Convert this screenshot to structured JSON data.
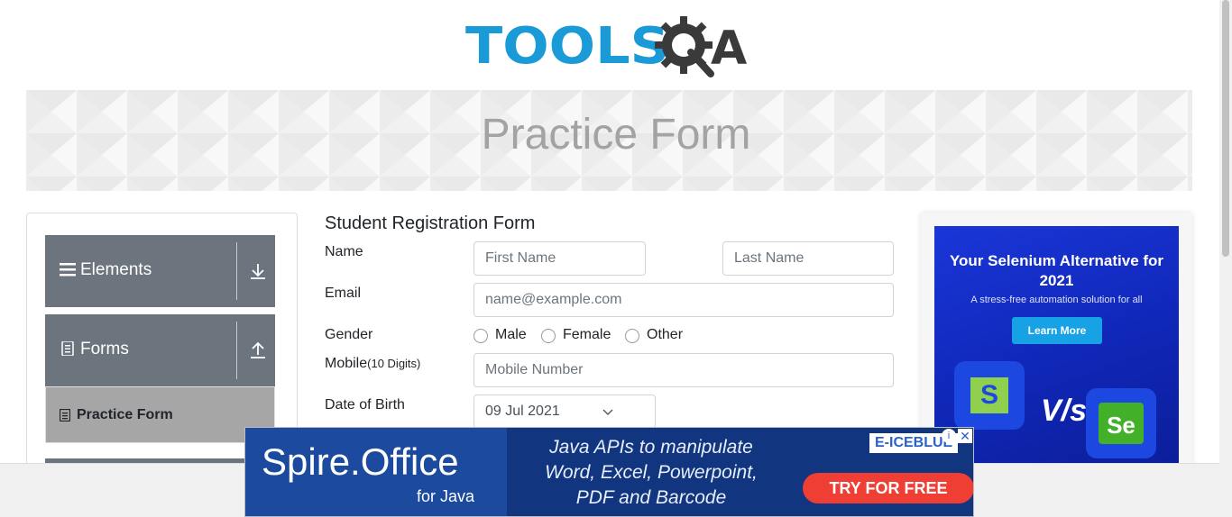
{
  "logo": {
    "text": "TOOLS",
    "suffix": "A",
    "icon": "gear-q-icon"
  },
  "banner": {
    "title": "Practice Form"
  },
  "sidebar": {
    "groups": [
      {
        "label": "Elements",
        "icon": "hamburger-icon",
        "arrow": "download-arrow-icon"
      },
      {
        "label": "Forms",
        "icon": "document-icon",
        "arrow": "upload-arrow-icon"
      }
    ],
    "active_item": {
      "label": "Practice Form",
      "icon": "file-icon"
    }
  },
  "form": {
    "title": "Student Registration Form",
    "name_label": "Name",
    "first_name_placeholder": "First Name",
    "last_name_placeholder": "Last Name",
    "email_label": "Email",
    "email_placeholder": "name@example.com",
    "gender_label": "Gender",
    "gender_options": [
      "Male",
      "Female",
      "Other"
    ],
    "mobile_label": "Mobile",
    "mobile_hint": "(10 Digits)",
    "mobile_placeholder": "Mobile Number",
    "dob_label": "Date of Birth",
    "dob_value": "09 Jul 2021"
  },
  "right_ad": {
    "title": "Your Selenium Alternative for 2021",
    "subtitle": "A stress-free automation solution for all",
    "button": "Learn More",
    "vs": "V/s",
    "logo_left": "S",
    "logo_right": "Se"
  },
  "bottom_ad": {
    "title": "Spire.Office",
    "subtitle": "for Java",
    "text": "Java APIs to manipulate Word, Excel, Powerpoint, PDF and Barcode",
    "cta": "TRY FOR FREE",
    "brand": "E-ICEBLUE",
    "close": "✕",
    "info": "i"
  },
  "colors": {
    "brand_blue": "#1a9ad6",
    "sidebar_gray": "#6c757d",
    "active_item": "#a6a6a6",
    "cta_red": "#ef3e33"
  }
}
